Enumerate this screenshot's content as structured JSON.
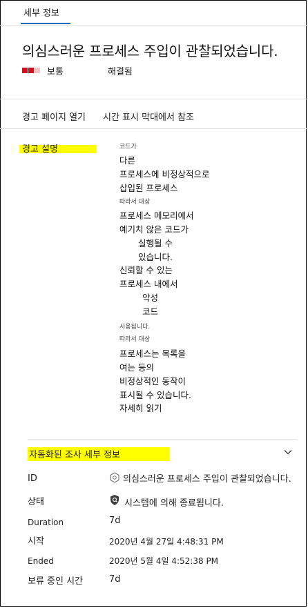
{
  "tab": {
    "label": "세부 정보"
  },
  "alert": {
    "title": "의심스러운 프로세스 주입이 관찰되었습니다.",
    "severity": "보통",
    "status": "해결됨"
  },
  "colors": {
    "severity_high": "#d0101b",
    "severity_low": "#f3c2c5",
    "highlight": "#ffff00",
    "accent": "#0f6cbd"
  },
  "actions": {
    "open_page": "경고 페이지 열기",
    "view_timeline": "시간 표시 막대에서 참조"
  },
  "description": {
    "label": "경고 설명",
    "lines": [
      "코드가",
      "다른",
      "프로세스에 비정상적으로",
      "삽입된 프로세스",
      "따라서 대상",
      "프로세스 메모리에서",
      "예기치 않은 코드가",
      "실행될 수",
      "있습니다.",
      "신뢰할 수 있는",
      "프로세스 내에서",
      "악성",
      "코드",
      "사용됩니다.",
      "따라서 대상",
      "프로세스는 목록을",
      "여는 등의",
      "비정상적인 동작이",
      "표시될 수 있습니다.",
      "자세히 읽기"
    ]
  },
  "investigation": {
    "section_title": "자동화된 조사 세부 정보",
    "chevron_icon": "chevron-down-icon",
    "rows": [
      {
        "label": "ID",
        "value": "의심스러운 프로세스 주입이 관찰되었습니다.",
        "icon": "hexagon-icon"
      },
      {
        "label": "상태",
        "value": "시스템에 의해 종료됩니다.",
        "icon": "shield-icon"
      },
      {
        "label": "Duration",
        "value": "7d"
      },
      {
        "label": "시작",
        "value": "2020년 4월 27일 4:48:31 PM"
      },
      {
        "label": "Ended",
        "value": "2020년 5월 4일 4:52:38 PM"
      },
      {
        "label": "보류 중인 시간",
        "value": "7d"
      }
    ]
  }
}
